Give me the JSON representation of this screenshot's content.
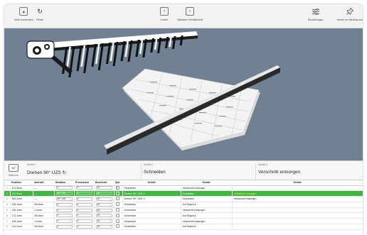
{
  "toolbar": {
    "left": [
      {
        "label": "Seite umwenden",
        "icon": "page-flip-icon"
      },
      {
        "label": "Reset",
        "icon": "reset-icon"
      }
    ],
    "center": [
      {
        "label": "Letzter",
        "icon": "previous-icon"
      },
      {
        "label": "Nächster Schnittschritt",
        "icon": "next-step-icon"
      }
    ],
    "right": [
      {
        "label": "Einstellungen",
        "icon": "settings-sliders-icon"
      },
      {
        "label": "Immer im Vordergrund",
        "icon": "pin-icon"
      }
    ]
  },
  "viewport": {
    "background": "#6f8192"
  },
  "steps": {
    "icon_label": "Seite neu",
    "icon_text": "N7",
    "items": [
      {
        "num": "Schritt 1",
        "title": "Drehen 90° UZS ↻"
      },
      {
        "num": "Schritt 2",
        "title": "Schneiden"
      },
      {
        "num": "Schritt 3",
        "title": "Verschnitt entsorgen"
      }
    ]
  },
  "table": {
    "headers": [
      "",
      "Position",
      "Intervall",
      "Rotation",
      "Pressdruck",
      "Beschnitt",
      "Sjst",
      "Schritt",
      "Schritt",
      "Schritt"
    ],
    "rows": [
      {
        "num": "1",
        "position": "101.5mm",
        "interval": "—",
        "rotation": "0",
        "druck": "0",
        "besch": "10",
        "check": "✓",
        "s1": "Schneiden",
        "s2": "Verschnitt entsorgen",
        "s3": "",
        "selected": false
      },
      {
        "num": "2",
        "position": "121.5mm",
        "interval": "—",
        "rotation": "90° CW",
        "druck": "0",
        "besch": "10",
        "check": "",
        "s1": "Drehen 90° UZS ↻",
        "s2": "Schneiden",
        "s3": "Verschnitt entsorgen",
        "selected": true
      },
      {
        "num": "3",
        "position": "282.2mm",
        "interval": "—",
        "rotation": "90° CW",
        "druck": "0",
        "besch": "10",
        "check": "",
        "s1": "Drehen 90° UZS ↻",
        "s2": "Schneiden",
        "s3": "Verschnitt entsorgen",
        "selected": false
      },
      {
        "num": "4",
        "position": "226.1mm",
        "interval": "55.0mm",
        "rotation": "0",
        "druck": "0",
        "besch": "10",
        "check": "",
        "s1": "Schneiden",
        "s2": "Auf Stapel A",
        "s3": "",
        "selected": false
      },
      {
        "num": "5",
        "position": "226.1mm",
        "interval": "2.0mm",
        "rotation": "0",
        "druck": "0",
        "besch": "10",
        "check": "",
        "s1": "Schneiden",
        "s2": "Verschnitt entsorgen",
        "s3": "",
        "selected": false
      },
      {
        "num": "6",
        "position": "171.1mm",
        "interval": "55.0mm",
        "rotation": "0",
        "druck": "0",
        "besch": "10",
        "check": "",
        "s1": "Schneiden",
        "s2": "Auf Stapel A",
        "s3": "",
        "selected": false
      },
      {
        "num": "7",
        "position": "169.1mm",
        "interval": "2.0mm",
        "rotation": "0",
        "druck": "0",
        "besch": "10",
        "check": "",
        "s1": "Schneiden",
        "s2": "Verschnitt entsorgen",
        "s3": "",
        "selected": false
      },
      {
        "num": "8",
        "position": "114.1mm",
        "interval": "55.0mm",
        "rotation": "0",
        "druck": "0",
        "besch": "10",
        "check": "",
        "s1": "Schneiden",
        "s2": "Auf Stapel A",
        "s3": "",
        "selected": false
      }
    ]
  },
  "colors": {
    "selected_row": "#3fb83f",
    "highlight_text": "#ffe566",
    "viewport": "#6f8192"
  }
}
